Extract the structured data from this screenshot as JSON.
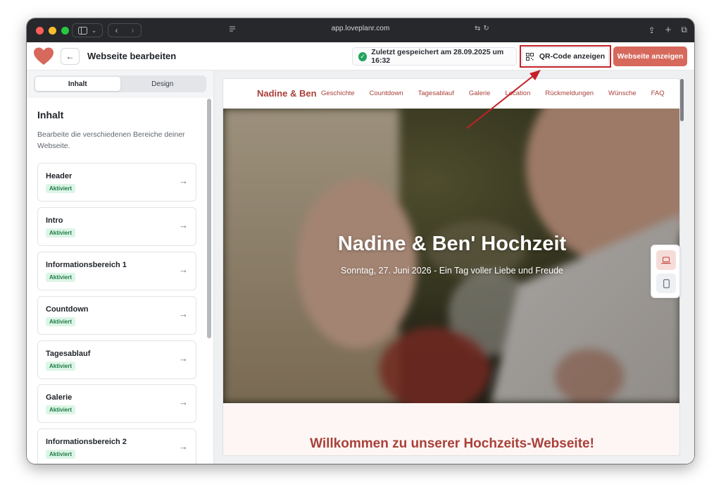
{
  "browser": {
    "address": "app.loveplanr.com"
  },
  "header": {
    "title": "Webseite bearbeiten",
    "save_status": "Zuletzt gespeichert am 28.09.2025 um 16:32",
    "qr_button": "QR-Code anzeigen",
    "view_button": "Webseite anzeigen"
  },
  "sidebar": {
    "tabs": [
      {
        "label": "Inhalt",
        "active": true
      },
      {
        "label": "Design",
        "active": false
      }
    ],
    "section_title": "Inhalt",
    "section_desc": "Bearbeite die verschiedenen Bereiche deiner Webseite.",
    "items": [
      {
        "title": "Header",
        "badge": "Aktiviert"
      },
      {
        "title": "Intro",
        "badge": "Aktiviert"
      },
      {
        "title": "Informationsbereich 1",
        "badge": "Aktiviert"
      },
      {
        "title": "Countdown",
        "badge": "Aktiviert"
      },
      {
        "title": "Tagesablauf",
        "badge": "Aktiviert"
      },
      {
        "title": "Galerie",
        "badge": "Aktiviert"
      },
      {
        "title": "Informationsbereich 2",
        "badge": "Aktiviert"
      }
    ]
  },
  "preview": {
    "brand": "Nadine & Ben",
    "nav": [
      "Geschichte",
      "Countdown",
      "Tagesablauf",
      "Galerie",
      "Location",
      "Rückmeldungen",
      "Wünsche",
      "FAQ"
    ],
    "hero_title": "Nadine & Ben' Hochzeit",
    "hero_subtitle": "Sonntag, 27. Juni 2026 - Ein Tag voller Liebe und Freude",
    "welcome": "Willkommen zu unserer Hochzeits-Webseite!"
  },
  "colors": {
    "accent": "#d6685c",
    "brand_text": "#a8413a",
    "success": "#22a45d",
    "highlight": "#c42127"
  }
}
